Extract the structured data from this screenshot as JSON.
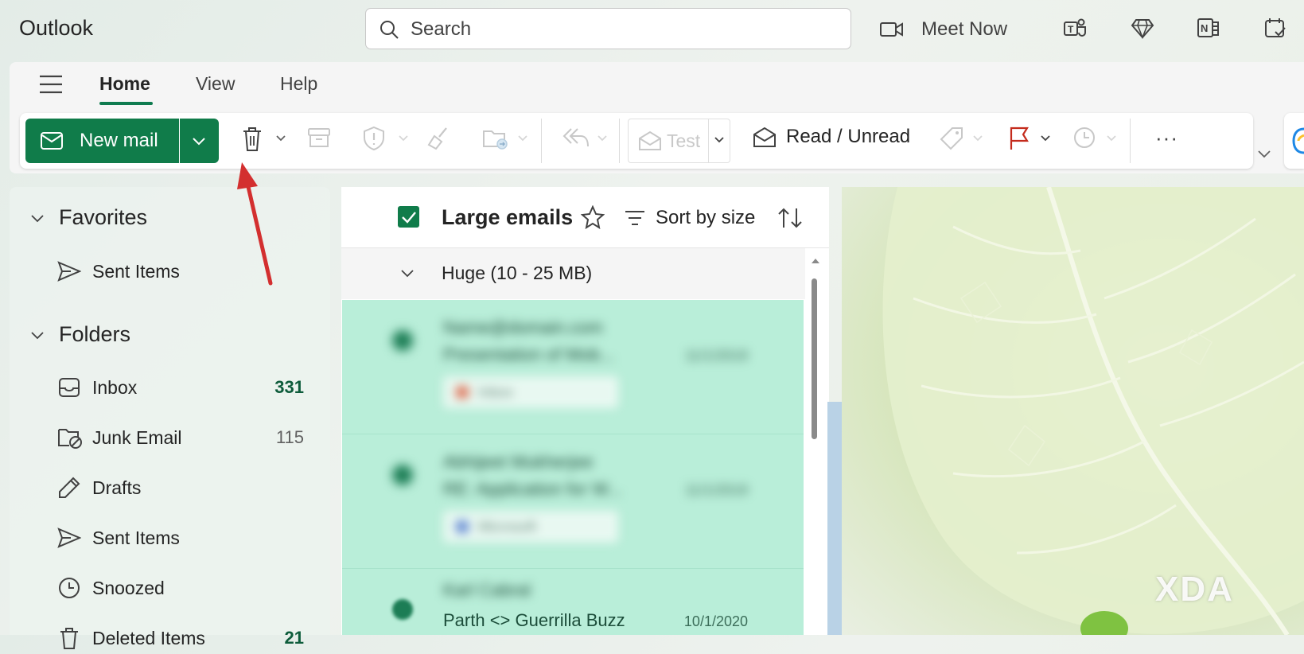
{
  "app": {
    "title": "Outlook"
  },
  "search": {
    "placeholder": "Search"
  },
  "top_bar": {
    "meet_now_label": "Meet Now",
    "icons": [
      "video-camera-icon",
      "teams-icon",
      "premium-diamond-icon",
      "onenote-icon",
      "todo-icon"
    ]
  },
  "ribbon": {
    "tabs": [
      {
        "label": "Home",
        "active": true
      },
      {
        "label": "View",
        "active": false
      },
      {
        "label": "Help",
        "active": false
      }
    ],
    "new_mail_label": "New mail",
    "test_label": "Test",
    "read_unread_label": "Read / Unread",
    "more_label": "···",
    "icons": [
      "delete-icon",
      "archive-icon",
      "report-icon",
      "sweep-icon",
      "move-to-icon",
      "reply-all-icon",
      "tag-icon",
      "flag-icon",
      "snooze-icon"
    ]
  },
  "nav": {
    "favorites": {
      "title": "Favorites",
      "items": [
        {
          "label": "Sent Items",
          "icon": "send-icon"
        }
      ]
    },
    "folders": {
      "title": "Folders",
      "items": [
        {
          "label": "Inbox",
          "count": "331",
          "icon": "inbox-icon"
        },
        {
          "label": "Junk Email",
          "count": "115",
          "icon": "junk-icon"
        },
        {
          "label": "Drafts",
          "count": "",
          "icon": "pencil-icon"
        },
        {
          "label": "Sent Items",
          "count": "",
          "icon": "send-icon"
        },
        {
          "label": "Snoozed",
          "count": "",
          "icon": "clock-icon"
        },
        {
          "label": "Deleted Items",
          "count": "21",
          "icon": "delete-icon"
        }
      ]
    }
  },
  "message_list": {
    "title": "Large emails",
    "sort_label": "Sort by size",
    "group_label": "Huge (10 - 25 MB)",
    "messages": [
      {
        "sender": "Name@domain.com",
        "subject": "Presentation of Mob...",
        "date": "11/1/2019",
        "chip": "Inbox",
        "chip_color": "#e07a5f",
        "selected": true
      },
      {
        "sender": "Abhijeet Mukherjee",
        "subject": "RE: Application for W...",
        "date": "11/1/2019",
        "chip": "Microsoft",
        "chip_color": "#6b8fd6",
        "selected": true
      },
      {
        "sender": "Karl Cabral",
        "subject": "Parth <> Guerrilla Buzz",
        "date": "10/1/2020",
        "chip": "",
        "chip_color": "",
        "selected": true
      }
    ]
  },
  "colors": {
    "accent": "#107c4a",
    "selected_row": "#b9eed9",
    "annotation": "#d32f2f"
  },
  "watermark": "XDA"
}
